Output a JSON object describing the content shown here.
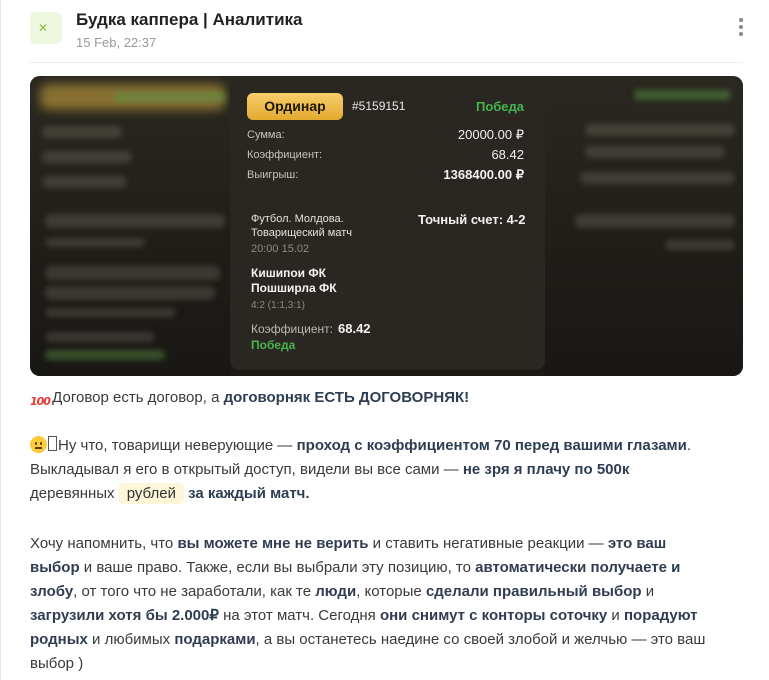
{
  "channel": {
    "name": "Будка каппера | Аналитика",
    "time": "15 Feb, 22:37"
  },
  "bet": {
    "type": "Ординар",
    "id": "#5159151",
    "status": "Победа",
    "rows": [
      {
        "label": "Сумма:",
        "value": "20000.00 ₽"
      },
      {
        "label": "Коэффициент:",
        "value": "68.42"
      },
      {
        "label": "Выигрыш:",
        "value": "1368400.00 ₽"
      }
    ],
    "match": {
      "league": "Футбол. Молдова. Товарищеский матч",
      "result": "Точный счет: 4-2",
      "datetime": "20:00 15.02",
      "team1": "Кишипои ФК",
      "team2": "Пошширла ФК",
      "score": "4:2 (1:1,3:1)",
      "coef_label": "Коэффициент:",
      "coef_value": "68.42",
      "status": "Победа"
    }
  },
  "text": {
    "l1_a": "Договор есть договор, а ",
    "l1_b": "договорняк ЕСТЬ ДОГОВОРНЯК!",
    "l2_a": "Ну что, товарищи неверующие — ",
    "l2_b": "проход с коэффициентом 70 перед вашими глазами",
    "l2_c": ".",
    "l3_a": "Выкладывал я его в открытый доступ, видели вы все сами — ",
    "l3_b": "не зря я плачу по 500к",
    "l4_a": "деревянных ",
    "l4_highlight": "рублей",
    "l4_b": "за каждый матч.",
    "l5_a": "Хочу напомнить, что ",
    "l5_b": "вы можете мне не верить",
    "l5_c": " и ставить негативные реакции — ",
    "l5_d": "это ваш",
    "l6_a": "выбор",
    "l6_b": " и ваше право. Также, если вы выбрали эту позицию, то ",
    "l6_c": "автоматически получаете и",
    "l7_a": "злобу",
    "l7_b": ", от того что не заработали, как те ",
    "l7_c": "люди",
    "l7_d": ", которые ",
    "l7_e": "сделали правильный выбор",
    "l7_f": " и",
    "l8_a": "загрузили хотя бы 2.000₽",
    "l8_b": " на этот матч. Сегодня ",
    "l8_c": "они снимут с конторы соточку",
    "l8_d": " и ",
    "l8_e": "порадуют",
    "l9_a": "родных",
    "l9_b": " и любимых ",
    "l9_c": "подарками",
    "l9_d": ", а вы останетесь наедине со своей злобой и желчью — это ваш",
    "l10": "выбор )"
  }
}
